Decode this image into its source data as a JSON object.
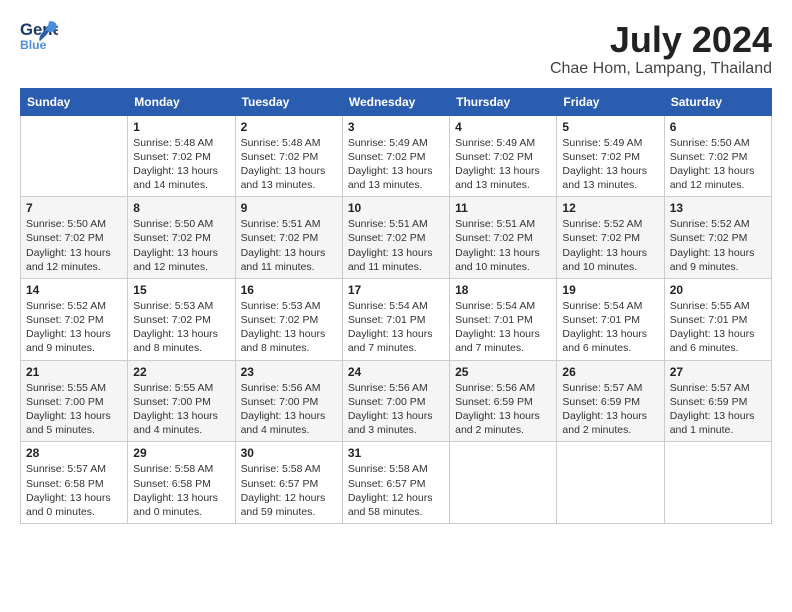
{
  "header": {
    "logo_general": "General",
    "logo_blue": "Blue",
    "month_year": "July 2024",
    "location": "Chae Hom, Lampang, Thailand"
  },
  "weekdays": [
    "Sunday",
    "Monday",
    "Tuesday",
    "Wednesday",
    "Thursday",
    "Friday",
    "Saturday"
  ],
  "weeks": [
    [
      {
        "day": "",
        "info": ""
      },
      {
        "day": "1",
        "info": "Sunrise: 5:48 AM\nSunset: 7:02 PM\nDaylight: 13 hours\nand 14 minutes."
      },
      {
        "day": "2",
        "info": "Sunrise: 5:48 AM\nSunset: 7:02 PM\nDaylight: 13 hours\nand 13 minutes."
      },
      {
        "day": "3",
        "info": "Sunrise: 5:49 AM\nSunset: 7:02 PM\nDaylight: 13 hours\nand 13 minutes."
      },
      {
        "day": "4",
        "info": "Sunrise: 5:49 AM\nSunset: 7:02 PM\nDaylight: 13 hours\nand 13 minutes."
      },
      {
        "day": "5",
        "info": "Sunrise: 5:49 AM\nSunset: 7:02 PM\nDaylight: 13 hours\nand 13 minutes."
      },
      {
        "day": "6",
        "info": "Sunrise: 5:50 AM\nSunset: 7:02 PM\nDaylight: 13 hours\nand 12 minutes."
      }
    ],
    [
      {
        "day": "7",
        "info": "Sunrise: 5:50 AM\nSunset: 7:02 PM\nDaylight: 13 hours\nand 12 minutes."
      },
      {
        "day": "8",
        "info": "Sunrise: 5:50 AM\nSunset: 7:02 PM\nDaylight: 13 hours\nand 12 minutes."
      },
      {
        "day": "9",
        "info": "Sunrise: 5:51 AM\nSunset: 7:02 PM\nDaylight: 13 hours\nand 11 minutes."
      },
      {
        "day": "10",
        "info": "Sunrise: 5:51 AM\nSunset: 7:02 PM\nDaylight: 13 hours\nand 11 minutes."
      },
      {
        "day": "11",
        "info": "Sunrise: 5:51 AM\nSunset: 7:02 PM\nDaylight: 13 hours\nand 10 minutes."
      },
      {
        "day": "12",
        "info": "Sunrise: 5:52 AM\nSunset: 7:02 PM\nDaylight: 13 hours\nand 10 minutes."
      },
      {
        "day": "13",
        "info": "Sunrise: 5:52 AM\nSunset: 7:02 PM\nDaylight: 13 hours\nand 9 minutes."
      }
    ],
    [
      {
        "day": "14",
        "info": "Sunrise: 5:52 AM\nSunset: 7:02 PM\nDaylight: 13 hours\nand 9 minutes."
      },
      {
        "day": "15",
        "info": "Sunrise: 5:53 AM\nSunset: 7:02 PM\nDaylight: 13 hours\nand 8 minutes."
      },
      {
        "day": "16",
        "info": "Sunrise: 5:53 AM\nSunset: 7:02 PM\nDaylight: 13 hours\nand 8 minutes."
      },
      {
        "day": "17",
        "info": "Sunrise: 5:54 AM\nSunset: 7:01 PM\nDaylight: 13 hours\nand 7 minutes."
      },
      {
        "day": "18",
        "info": "Sunrise: 5:54 AM\nSunset: 7:01 PM\nDaylight: 13 hours\nand 7 minutes."
      },
      {
        "day": "19",
        "info": "Sunrise: 5:54 AM\nSunset: 7:01 PM\nDaylight: 13 hours\nand 6 minutes."
      },
      {
        "day": "20",
        "info": "Sunrise: 5:55 AM\nSunset: 7:01 PM\nDaylight: 13 hours\nand 6 minutes."
      }
    ],
    [
      {
        "day": "21",
        "info": "Sunrise: 5:55 AM\nSunset: 7:00 PM\nDaylight: 13 hours\nand 5 minutes."
      },
      {
        "day": "22",
        "info": "Sunrise: 5:55 AM\nSunset: 7:00 PM\nDaylight: 13 hours\nand 4 minutes."
      },
      {
        "day": "23",
        "info": "Sunrise: 5:56 AM\nSunset: 7:00 PM\nDaylight: 13 hours\nand 4 minutes."
      },
      {
        "day": "24",
        "info": "Sunrise: 5:56 AM\nSunset: 7:00 PM\nDaylight: 13 hours\nand 3 minutes."
      },
      {
        "day": "25",
        "info": "Sunrise: 5:56 AM\nSunset: 6:59 PM\nDaylight: 13 hours\nand 2 minutes."
      },
      {
        "day": "26",
        "info": "Sunrise: 5:57 AM\nSunset: 6:59 PM\nDaylight: 13 hours\nand 2 minutes."
      },
      {
        "day": "27",
        "info": "Sunrise: 5:57 AM\nSunset: 6:59 PM\nDaylight: 13 hours\nand 1 minute."
      }
    ],
    [
      {
        "day": "28",
        "info": "Sunrise: 5:57 AM\nSunset: 6:58 PM\nDaylight: 13 hours\nand 0 minutes."
      },
      {
        "day": "29",
        "info": "Sunrise: 5:58 AM\nSunset: 6:58 PM\nDaylight: 13 hours\nand 0 minutes."
      },
      {
        "day": "30",
        "info": "Sunrise: 5:58 AM\nSunset: 6:57 PM\nDaylight: 12 hours\nand 59 minutes."
      },
      {
        "day": "31",
        "info": "Sunrise: 5:58 AM\nSunset: 6:57 PM\nDaylight: 12 hours\nand 58 minutes."
      },
      {
        "day": "",
        "info": ""
      },
      {
        "day": "",
        "info": ""
      },
      {
        "day": "",
        "info": ""
      }
    ]
  ]
}
